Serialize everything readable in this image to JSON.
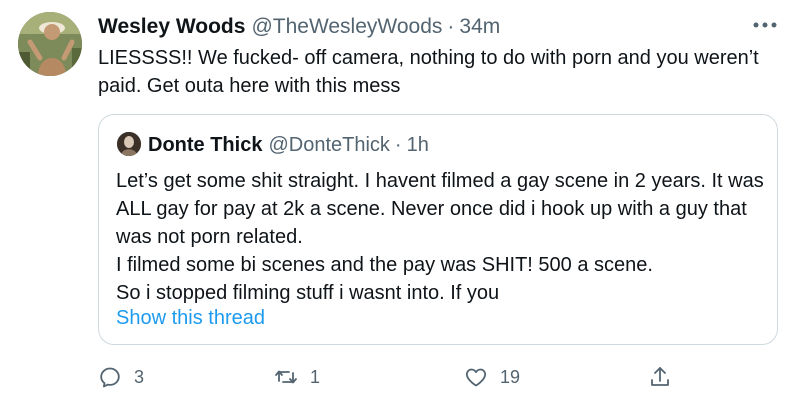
{
  "tweet": {
    "author_name": "Wesley Woods",
    "author_handle": "@TheWesleyWoods",
    "separator": "·",
    "time": "34m",
    "text": "LIESSSS!! We fucked- off camera, nothing to do with porn and you weren’t paid. Get outa here with this mess",
    "more_icon": "more-horizontal-icon"
  },
  "quoted_tweet": {
    "author_name": "Donte Thick",
    "author_handle": "@DonteThick",
    "separator": "·",
    "time": "1h",
    "lines": [
      "Let’s get some shit straight. I havent filmed a gay scene in 2 years. It was ALL gay for pay at 2k a scene. Never once did i hook up with a guy that was not porn related.",
      "I filmed some bi scenes and the pay was SHIT! 500 a scene.",
      "So i stopped filming stuff i wasnt into. If you"
    ],
    "show_thread_label": "Show this thread"
  },
  "actions": {
    "reply": {
      "icon": "reply-icon",
      "count": "3"
    },
    "retweet": {
      "icon": "retweet-icon",
      "count": "1"
    },
    "like": {
      "icon": "heart-icon",
      "count": "19"
    },
    "share": {
      "icon": "share-icon"
    }
  },
  "colors": {
    "text_primary": "#0f1419",
    "text_secondary": "#536471",
    "link": "#1d9bf0",
    "border": "#cfd9de"
  }
}
